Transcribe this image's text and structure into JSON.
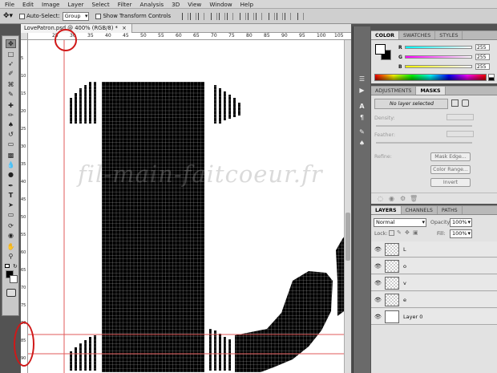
{
  "menubar": {
    "items": [
      "File",
      "Edit",
      "Image",
      "Layer",
      "Select",
      "Filter",
      "Analysis",
      "3D",
      "View",
      "Window",
      "Help"
    ]
  },
  "options": {
    "auto_select_label": "Auto-Select:",
    "auto_select_value": "Group",
    "show_transform_label": "Show Transform Controls"
  },
  "document": {
    "tab_title": "LovePatron.psd @ 400% (RGB/8) *",
    "ruler_top_ticks": [
      "25",
      "30",
      "35",
      "40",
      "45",
      "50",
      "55",
      "60",
      "65",
      "70",
      "75",
      "80",
      "85",
      "90",
      "95",
      "100",
      "105"
    ],
    "ruler_left_ticks": [
      "5",
      "10",
      "15",
      "20",
      "25",
      "30",
      "35",
      "40",
      "45",
      "50",
      "55",
      "60",
      "65",
      "70",
      "75",
      "80",
      "85",
      "90"
    ],
    "watermark": "fil-main-faitcoeur.fr"
  },
  "color_panel": {
    "tabs": [
      "COLOR",
      "SWATCHES",
      "STYLES"
    ],
    "r_label": "R",
    "r_value": "255",
    "g_label": "G",
    "g_value": "255",
    "b_label": "B",
    "b_value": "255"
  },
  "adjustments_panel": {
    "tabs": [
      "ADJUSTMENTS",
      "MASKS"
    ],
    "status": "No layer selected",
    "density_label": "Density:",
    "feather_label": "Feather:",
    "refine_label": "Refine:",
    "mask_edge_button": "Mask Edge...",
    "color_range_button": "Color Range...",
    "invert_button": "Invert"
  },
  "layers_panel": {
    "tabs": [
      "LAYERS",
      "CHANNELS",
      "PATHS"
    ],
    "blend_mode": "Normal",
    "opacity_label": "Opacity:",
    "opacity_value": "100%",
    "lock_label": "Lock:",
    "fill_label": "Fill:",
    "fill_value": "100%",
    "layers": [
      {
        "name": "L"
      },
      {
        "name": "o"
      },
      {
        "name": "v"
      },
      {
        "name": "e"
      },
      {
        "name": "Layer 0"
      }
    ]
  },
  "colors": {
    "accent_red": "#d01818",
    "pattern_black": "#000000",
    "guide_red": "#e25a5a"
  }
}
